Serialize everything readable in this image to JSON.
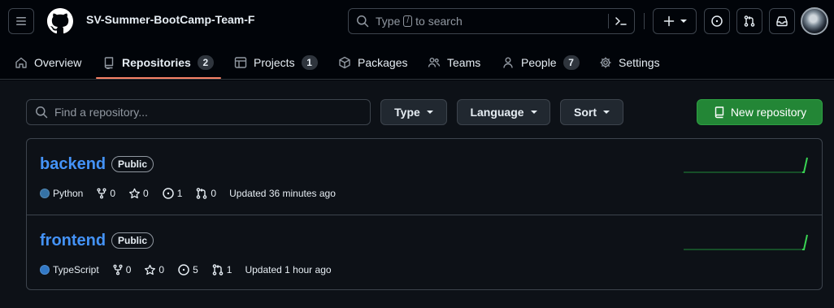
{
  "header": {
    "org_name": "SV-Summer-BootCamp-Team-F",
    "search_prefix": "Type",
    "search_key": "/",
    "search_suffix": "to search",
    "plus_label": "+"
  },
  "nav": {
    "items": [
      {
        "label": "Overview",
        "icon": "home-icon"
      },
      {
        "label": "Repositories",
        "icon": "repo-icon",
        "count": "2",
        "active": true
      },
      {
        "label": "Projects",
        "icon": "table-icon",
        "count": "1"
      },
      {
        "label": "Packages",
        "icon": "package-icon"
      },
      {
        "label": "Teams",
        "icon": "people-icon"
      },
      {
        "label": "People",
        "icon": "person-icon",
        "count": "7"
      },
      {
        "label": "Settings",
        "icon": "gear-icon"
      }
    ]
  },
  "toolbar": {
    "find_placeholder": "Find a repository...",
    "type_label": "Type",
    "language_label": "Language",
    "sort_label": "Sort",
    "new_repo_label": "New repository"
  },
  "repos": [
    {
      "name": "backend",
      "visibility": "Public",
      "language": "Python",
      "language_color": "#3572A5",
      "forks": "0",
      "stars": "0",
      "issues": "1",
      "pulls": "0",
      "updated": "Updated 36 minutes ago"
    },
    {
      "name": "frontend",
      "visibility": "Public",
      "language": "TypeScript",
      "language_color": "#3178c6",
      "forks": "0",
      "stars": "0",
      "issues": "5",
      "pulls": "1",
      "updated": "Updated 1 hour ago"
    }
  ],
  "colors": {
    "accent_link": "#4493f8",
    "primary_button": "#238636",
    "nav_underline": "#f78166"
  }
}
